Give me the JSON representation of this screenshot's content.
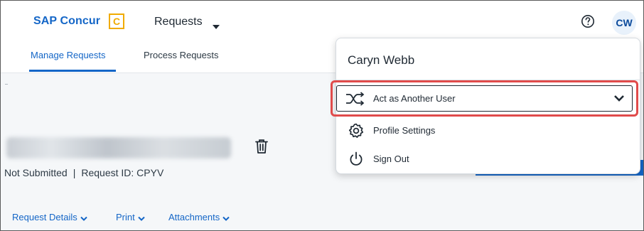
{
  "header": {
    "brand": "SAP Concur",
    "brand_mark": "C",
    "requests_menu": "Requests",
    "avatar_initials": "CW"
  },
  "tabs": [
    {
      "label": "Manage Requests",
      "active": true
    },
    {
      "label": "Process Requests",
      "active": false
    }
  ],
  "request": {
    "status": "Not Submitted",
    "separator": "|",
    "request_id": "Request ID: CPYV"
  },
  "bottom_links": [
    {
      "label": "Request Details"
    },
    {
      "label": "Print"
    },
    {
      "label": "Attachments"
    }
  ],
  "user_menu": {
    "user_name": "Caryn Webb",
    "items": [
      {
        "label": "Act as Another User",
        "icon": "shuffle-icon"
      },
      {
        "label": "Profile Settings",
        "icon": "gear-icon"
      },
      {
        "label": "Sign Out",
        "icon": "power-icon"
      }
    ]
  },
  "colors": {
    "brand_blue": "#1466c7",
    "brand_orange": "#f0ab00",
    "highlight_red": "#e04b4b"
  }
}
